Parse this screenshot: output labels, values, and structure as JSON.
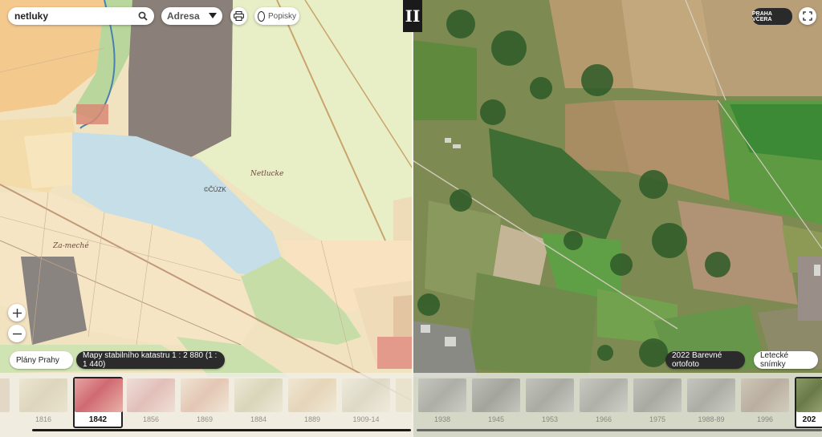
{
  "search": {
    "value": "netluky"
  },
  "address_select": {
    "label": "Adresa"
  },
  "labels_toggle": {
    "label": "Popisky"
  },
  "divider": {
    "symbol": "II"
  },
  "praha_vcera": {
    "label": "PRAHA VČERA"
  },
  "map_labels": {
    "cuzk": "©ČÚZK",
    "netlucke": "Netlucke",
    "zameche": "Za-meché"
  },
  "left_chips": {
    "plany": "Plány Prahy",
    "mapy": "Mapy stabilního katastru 1 : 2 880 (1 : 1 440)"
  },
  "right_chips": {
    "orto": "2022 Barevné ortofoto",
    "letecke": "Letecké snímky"
  },
  "timeline_left": [
    {
      "year": "1816"
    },
    {
      "year": "1842"
    },
    {
      "year": "1856"
    },
    {
      "year": "1869"
    },
    {
      "year": "1884"
    },
    {
      "year": "1889"
    },
    {
      "year": "1909-14"
    }
  ],
  "timeline_right": [
    {
      "year": "1938"
    },
    {
      "year": "1945"
    },
    {
      "year": "1953"
    },
    {
      "year": "1966"
    },
    {
      "year": "1975"
    },
    {
      "year": "1988-89"
    },
    {
      "year": "1996"
    },
    {
      "year": "202"
    }
  ],
  "active_year_left": "1842",
  "active_year_right": "202"
}
